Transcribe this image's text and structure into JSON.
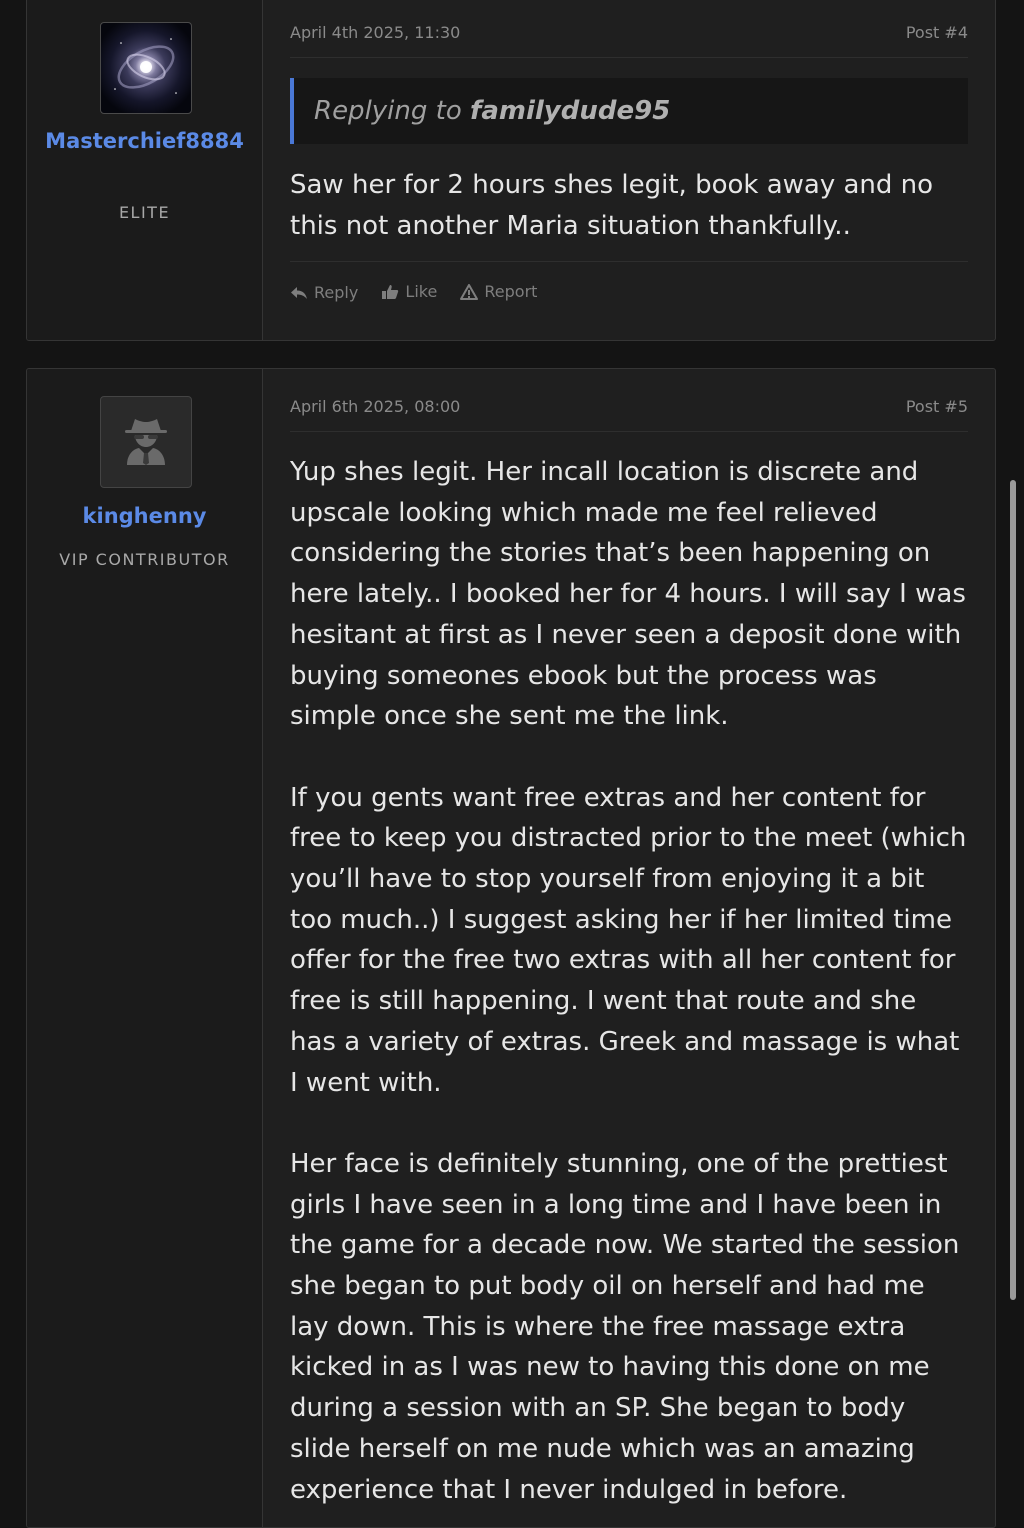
{
  "posts": [
    {
      "username": "Masterchief8884",
      "user_title": "ELITE",
      "date": "April 4th 2025, 11:30",
      "post_number": "Post #4",
      "quote_prefix": "Replying to",
      "quote_user": "familydude95",
      "paragraphs": [
        "Saw her for 2 hours shes legit, book away and no this not another Maria situation thankfully.."
      ],
      "actions": {
        "reply": "Reply",
        "like": "Like",
        "report": "Report"
      }
    },
    {
      "username": "kinghenny",
      "user_title": "VIP CONTRIBUTOR",
      "date": "April 6th 2025, 08:00",
      "post_number": "Post #5",
      "paragraphs": [
        "Yup shes legit. Her incall location is discrete and upscale looking which made me feel relieved considering the stories that’s been happening on here lately.. I booked her for 4 hours. I will say I was hesitant at first as I never seen a deposit done with buying someones ebook but the process was simple once she sent me the link.",
        "If you gents want free extras and her content for free to keep you distracted prior to the meet (which you’ll have to stop yourself from enjoying it a bit too much..) I suggest asking her if her limited time offer for the free two extras with all her content for free is still happening. I went that route and she has a variety of extras. Greek and massage is what I went with.",
        "Her face is definitely stunning, one of the prettiest girls I have seen in a long time and I have been in the game for a decade now. We started the session she began to put body oil on herself and had me lay down. This is where the free massage extra kicked in as I was new to having this done on me during a session with an SP. She began to body slide herself on me nude which was an amazing experience that I never indulged in before."
      ]
    }
  ],
  "icons": [
    "galaxy-avatar",
    "spy-avatar-icon",
    "reply-icon",
    "thumbs-up-icon",
    "warning-icon"
  ],
  "colors": {
    "username": "#5b8ae6",
    "quote_border": "#4a78d6",
    "background": "#141414",
    "panel": "#1f1f1f"
  }
}
